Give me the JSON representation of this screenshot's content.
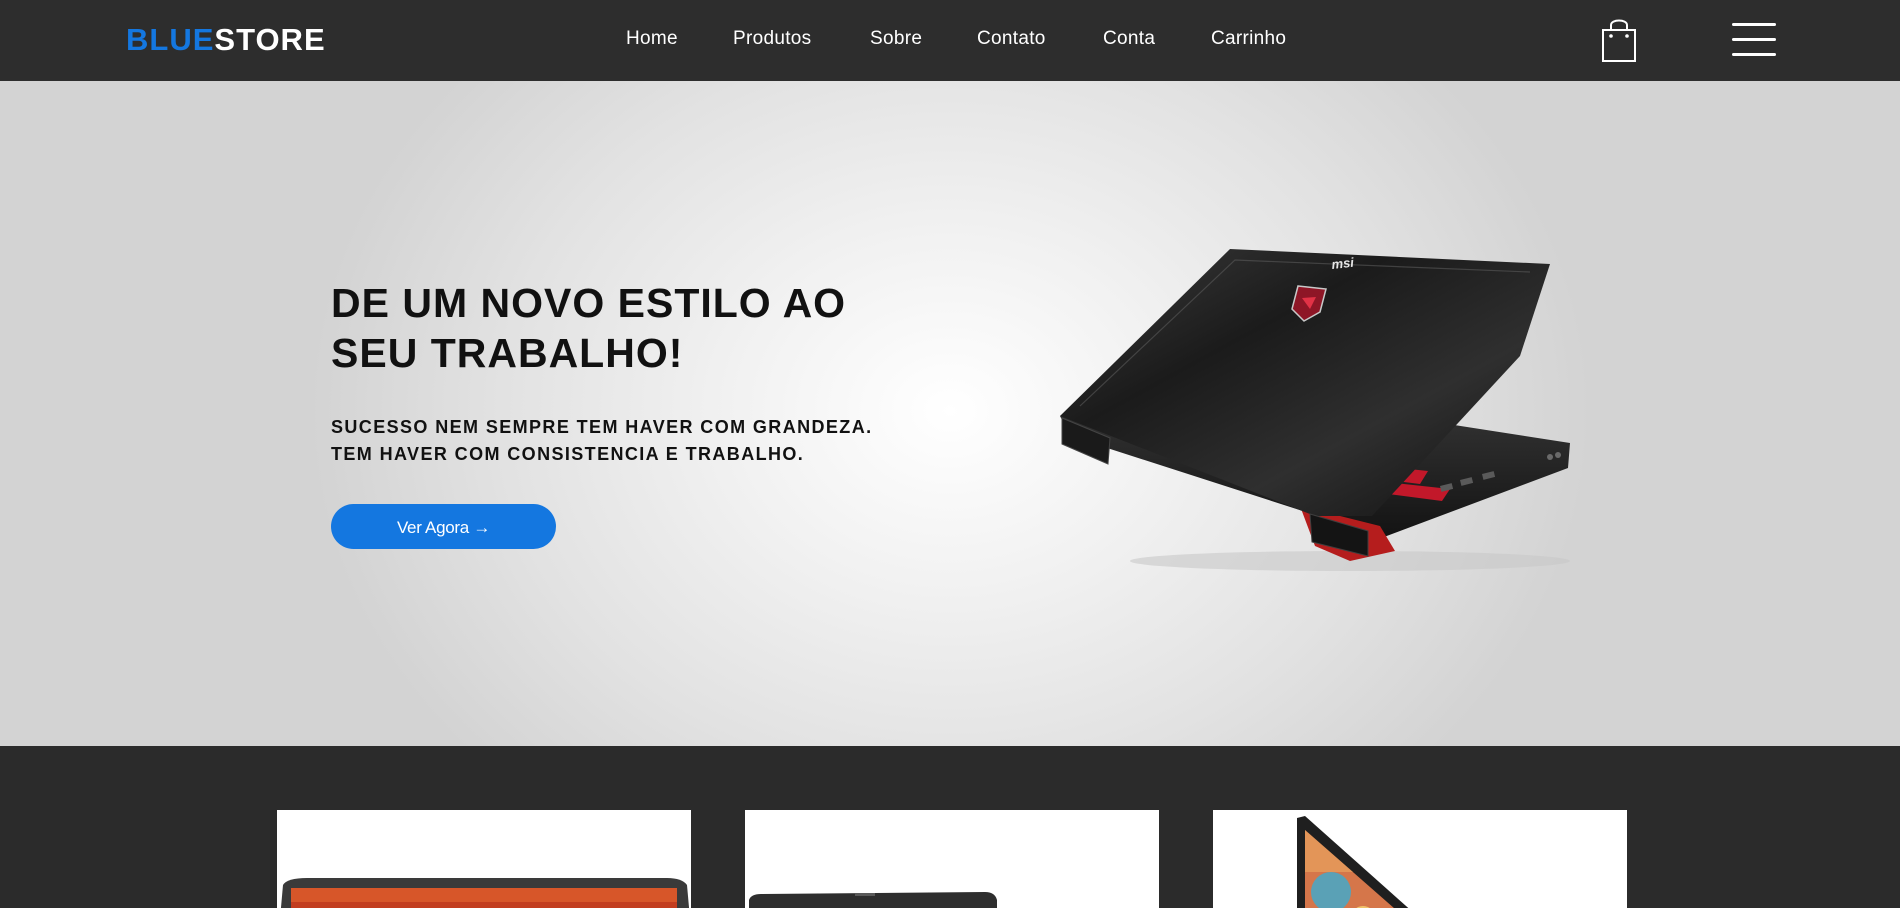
{
  "brand": {
    "part1": "BLUE",
    "part2": "STORE",
    "accent_color": "#1477e0"
  },
  "nav": {
    "items": [
      {
        "label": "Home"
      },
      {
        "label": "Produtos"
      },
      {
        "label": "Sobre"
      },
      {
        "label": "Contato"
      },
      {
        "label": "Conta"
      },
      {
        "label": "Carrinho"
      }
    ],
    "icons": {
      "cart": "shopping-bag-icon",
      "menu": "hamburger-menu-icon"
    }
  },
  "hero": {
    "title": "DE UM NOVO ESTILO AO SEU TRABALHO!",
    "subtitle_line1": "SUCESSO NEM SEMPRE TEM HAVER COM GRANDEZA.",
    "subtitle_line2": "TEM HAVER COM CONSISTENCIA E TRABALHO.",
    "cta_label": "Ver Agora →",
    "image": "laptop-product-image",
    "logo_text": "msi"
  },
  "products": {
    "cards": [
      {
        "image": "laptop-red-screen-image"
      },
      {
        "image": "laptop-dark-image"
      },
      {
        "image": "laptop-colorful-screen-image"
      }
    ]
  }
}
